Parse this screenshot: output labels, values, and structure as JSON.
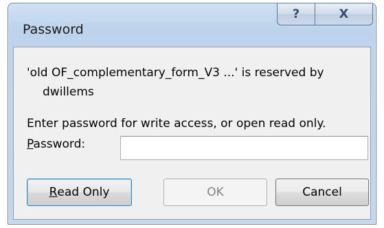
{
  "window": {
    "title": "Password",
    "help_glyph": "?",
    "close_glyph": "X"
  },
  "message": {
    "line1": "'old OF_complementary_form_V3 ...' is reserved by",
    "line2": "dwillems",
    "instruction": "Enter password for write access, or open read only."
  },
  "password": {
    "label_accel": "P",
    "label_rest": "assword:",
    "value": ""
  },
  "buttons": {
    "read_only_accel": "R",
    "read_only_rest": "ead Only",
    "ok": "OK",
    "cancel": "Cancel"
  }
}
